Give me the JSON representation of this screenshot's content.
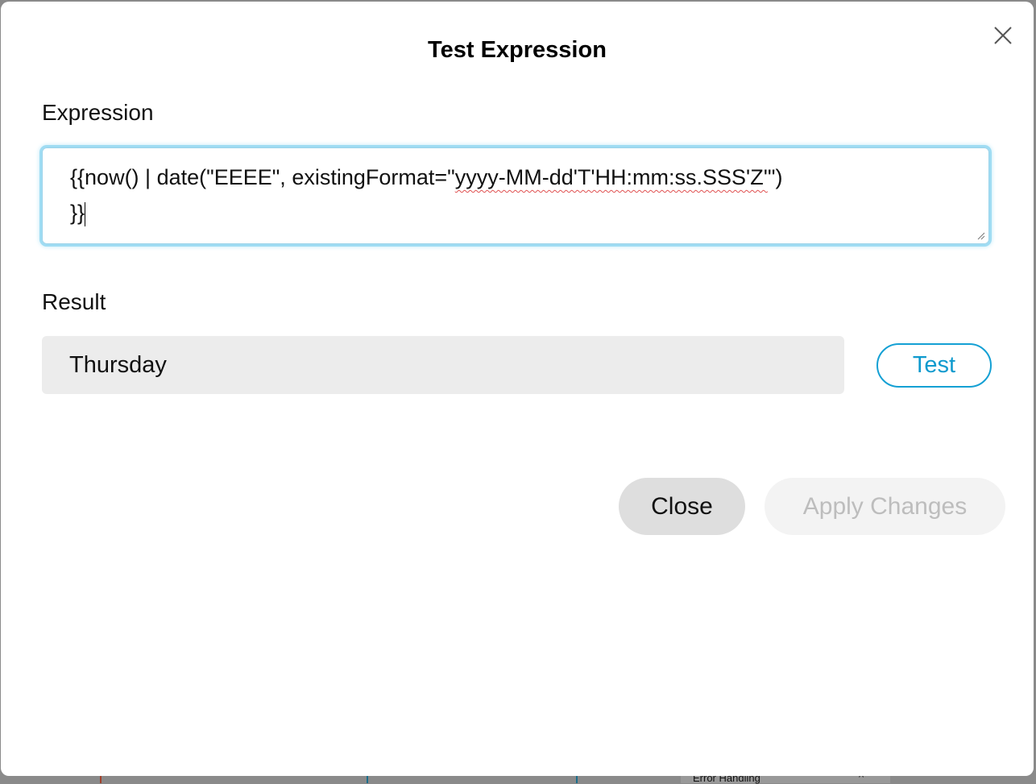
{
  "dialog": {
    "title": "Test Expression",
    "expression_label": "Expression",
    "expression_part1": "{{now() | date(\"EEEE\", existingFormat=\"",
    "expression_misspelled": "yyyy-MM-dd'T'HH:mm:ss.SSS'Z'",
    "expression_part2": "\")",
    "expression_line2": "}}",
    "result_label": "Result",
    "result_value": "Thursday",
    "test_label": "Test",
    "close_label": "Close",
    "apply_label": "Apply Changes"
  },
  "background": {
    "section_label": "Error Handling"
  },
  "colors": {
    "accent": "#14a0d4",
    "focus_glow": "#9fdcf3"
  }
}
